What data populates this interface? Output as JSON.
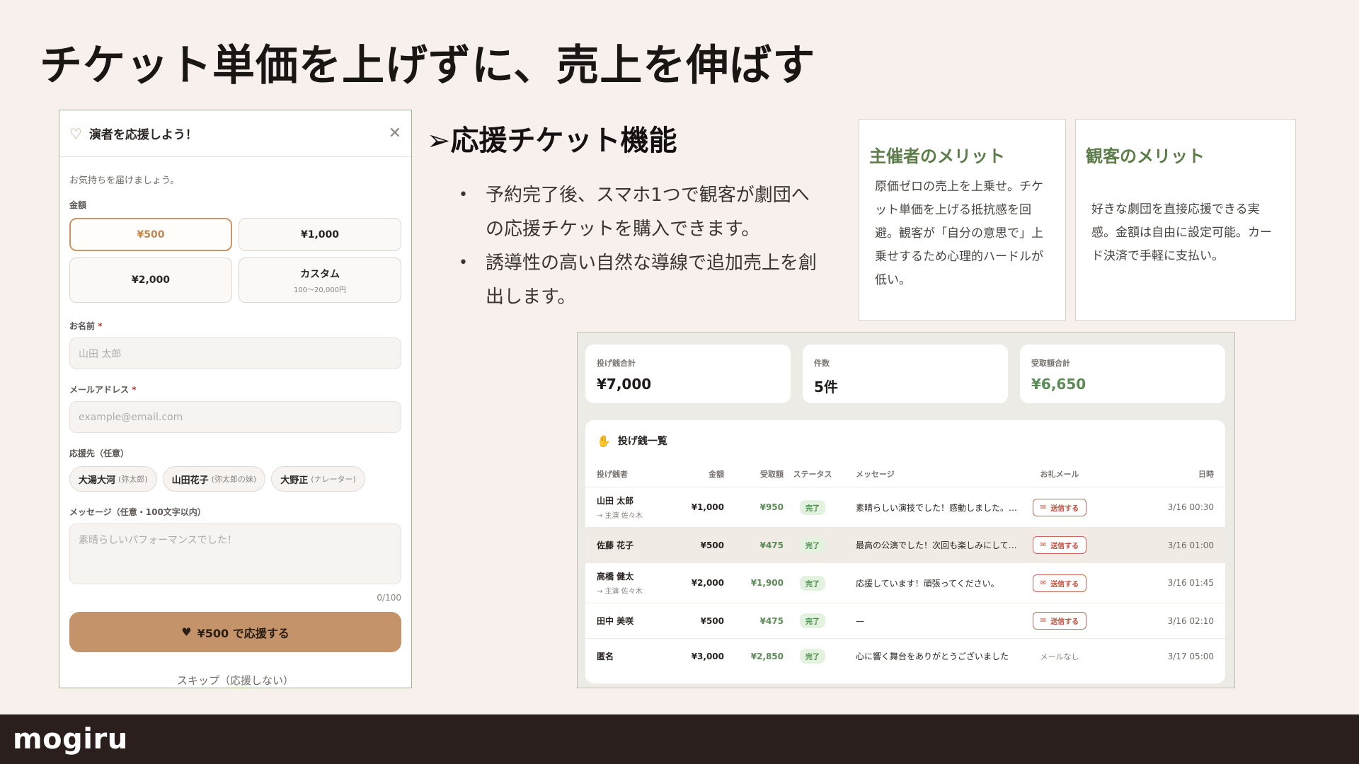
{
  "page": {
    "title": "チケット単価を上げずに、売上を伸ばす",
    "brand": "mogiru"
  },
  "modal": {
    "title": "演者を応援しよう！",
    "subtitle": "お気持ちを届けましょう。",
    "amount_label": "金額",
    "amounts": [
      {
        "label": "¥500",
        "sub": "",
        "selected": true
      },
      {
        "label": "¥1,000",
        "sub": "",
        "selected": false
      },
      {
        "label": "¥2,000",
        "sub": "",
        "selected": false
      },
      {
        "label": "カスタム",
        "sub": "100〜20,000円",
        "selected": false
      }
    ],
    "name_label": "お名前",
    "name_placeholder": "山田 太郎",
    "email_label": "メールアドレス",
    "email_placeholder": "example@email.com",
    "required_mark": "*",
    "target_label": "応援先（任意）",
    "targets": [
      {
        "name": "大湯大河",
        "sub": "(弥太郎)"
      },
      {
        "name": "山田花子",
        "sub": "(弥太郎の妹)"
      },
      {
        "name": "大野正",
        "sub": "(ナレーター)"
      }
    ],
    "message_label": "メッセージ（任意・100文字以内）",
    "message_placeholder": "素晴らしいパフォーマンスでした！",
    "counter": "0/100",
    "submit_label": "¥500 で応援する",
    "skip_label": "スキップ（応援しない）"
  },
  "feature": {
    "title": "➢応援チケット機能",
    "bullets": [
      "予約完了後、スマホ1つで観客が劇団への応援チケットを購入できます。",
      "誘導性の高い自然な導線で追加売上を創出します。"
    ]
  },
  "merits": {
    "organizer": {
      "title": "主催者のメリット",
      "body": "原価ゼロの売上を上乗せ。チケット単価を上げる抵抗感を回避。観客が「自分の意思で」上乗せするため心理的ハードルが低い。"
    },
    "audience": {
      "title": "観客のメリット",
      "body": "好きな劇団を直接応援できる実感。金額は自由に設定可能。カード決済で手軽に支払い。"
    }
  },
  "dashboard": {
    "stats": [
      {
        "label": "投げ銭合計",
        "value": "¥7,000",
        "green": false
      },
      {
        "label": "件数",
        "value": "5件",
        "green": false
      },
      {
        "label": "受取額合計",
        "value": "¥6,650",
        "green": true
      }
    ],
    "list_title": "投げ銭一覧",
    "columns": [
      "投げ銭者",
      "金額",
      "受取額",
      "ステータス",
      "メッセージ",
      "お礼メール",
      "日時"
    ],
    "rows": [
      {
        "name": "山田 太郎",
        "sub": "→ 主演 佐々木",
        "amount": "¥1,000",
        "received": "¥950",
        "status": "完了",
        "message": "素晴らしい演技でした！感動しました。ま…",
        "mail": "送信する",
        "date": "3/16 00:30"
      },
      {
        "name": "佐藤 花子",
        "sub": "",
        "amount": "¥500",
        "received": "¥475",
        "status": "完了",
        "message": "最高の公演でした！次回も楽しみにしてい…",
        "mail": "送信する",
        "date": "3/16 01:00"
      },
      {
        "name": "高橋 健太",
        "sub": "→ 主演 佐々木",
        "amount": "¥2,000",
        "received": "¥1,900",
        "status": "完了",
        "message": "応援しています！頑張ってください。",
        "mail": "送信する",
        "date": "3/16 01:45"
      },
      {
        "name": "田中 美咲",
        "sub": "",
        "amount": "¥500",
        "received": "¥475",
        "status": "完了",
        "message": "—",
        "mail": "送信する",
        "date": "3/16 02:10"
      },
      {
        "name": "匿名",
        "sub": "",
        "amount": "¥3,000",
        "received": "¥2,850",
        "status": "完了",
        "message": "心に響く舞台をありがとうございました",
        "mail": "メールなし",
        "date": "3/17 05:00"
      }
    ]
  }
}
